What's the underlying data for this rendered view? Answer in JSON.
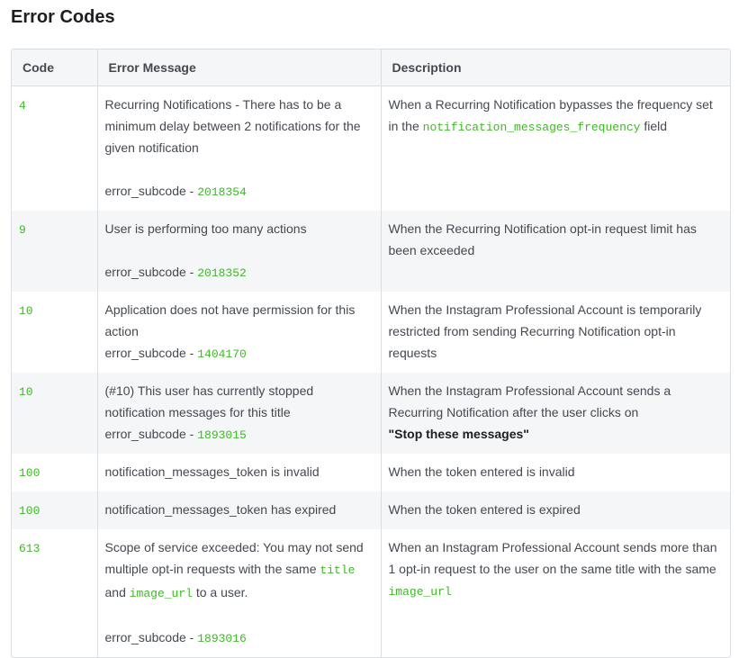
{
  "page": {
    "title": "Error Codes"
  },
  "table": {
    "headers": [
      "Code",
      "Error Message",
      "Description"
    ],
    "subcode_label": "error_subcode - ",
    "rows": [
      {
        "code": "4",
        "message": "Recurring Notifications - There has to be a minimum delay between 2 notifications for the given notification",
        "subcode": "2018354",
        "desc_pre": "When a Recurring Notification bypasses the frequency set in the ",
        "desc_code": "notification_messages_frequency",
        "desc_post": " field"
      },
      {
        "code": "9",
        "message": "User is performing too many actions",
        "subcode": "2018352",
        "desc": "When the Recurring Notification opt-in request limit has been exceeded"
      },
      {
        "code": "10",
        "message": "Application does not have permission for this action",
        "subcode": "1404170",
        "desc": "When the Instagram Professional Account is temporarily restricted from sending Recurring Notification opt-in requests"
      },
      {
        "code": "10",
        "message": "(#10) This user has currently stopped notification messages for this title",
        "subcode": "1893015",
        "desc": "When the Instagram Professional Account sends a Recurring Notification after the user clicks on",
        "desc_bold": "\"Stop these messages\""
      },
      {
        "code": "100",
        "message": "notification_messages_token is invalid",
        "desc": "When the token entered is invalid"
      },
      {
        "code": "100",
        "message": "notification_messages_token has expired",
        "desc": "When the token entered is expired"
      },
      {
        "code": "613",
        "message_pre": "Scope of service exceeded: You may not send multiple opt-in requests with the same ",
        "message_code1": "title",
        "message_mid": " and ",
        "message_code2": "image_url",
        "message_post": " to a user.",
        "subcode": "1893016",
        "desc_pre": "When an Instagram Professional Account sends more than 1 opt-in request to the user on the same title with the same ",
        "desc_code": "image_url"
      }
    ]
  },
  "colors": {
    "code_green": "#42b72a",
    "header_bg": "#f5f6f7",
    "border": "#dadde1"
  }
}
